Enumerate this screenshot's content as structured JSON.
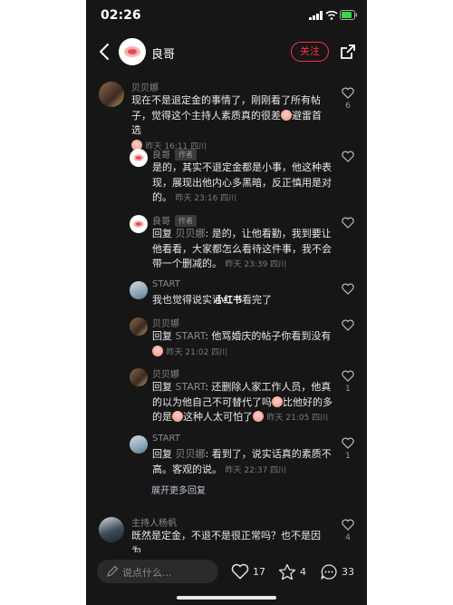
{
  "status": {
    "time": "02:26"
  },
  "header": {
    "name": "良哥",
    "follow_label": "关注"
  },
  "comments": [
    {
      "name": "贝贝娜",
      "text": "现在不是退定金的事情了，刚刚看了所有帖子，觉得这个主持人素质真的很差",
      "text_tail": "避雷首选",
      "meta": "昨天 16:11 四川",
      "likes": "6",
      "replies": [
        {
          "name": "良哥",
          "tag": "作者",
          "text": "是的，其实不退定金都是小事，他这种表现，展现出他内心多黑暗，反正慎用是对的。",
          "meta": "昨天 23:16 四川",
          "likes": ""
        },
        {
          "name": "良哥",
          "tag": "作者",
          "reply_prefix": "回复 ",
          "reply_to": "贝贝娜",
          "text": ": 是的，让他看勤，我到要让他看看，大家都怎么看待这件事，我不会带一个删减的。",
          "meta": "昨天 23:39 四川",
          "likes": ""
        },
        {
          "name": "START",
          "text": "我也觉得说实话",
          "text_tail": "看完了",
          "meta": "",
          "likes": ""
        },
        {
          "name": "贝贝娜",
          "reply_prefix": "回复 ",
          "reply_to": "START",
          "text": ": 他骂婚庆的帖子你看到没有",
          "meta": "昨天 21:02 四川",
          "likes": ""
        },
        {
          "name": "贝贝娜",
          "reply_prefix": "回复 ",
          "reply_to": "START",
          "text": ": 还删除人家工作人员，他真的以为他自己不可替代了吗",
          "text_mid": "比他好的多的是",
          "text_tail": "这种人太可怕了",
          "meta": "昨天 21:05 四川",
          "likes": "1"
        },
        {
          "name": "START",
          "reply_prefix": "回复 ",
          "reply_to": "贝贝娜",
          "text": ": 看到了，说实话真的素质不高。客观的说。",
          "meta": "昨天 22:37 四川",
          "likes": "1"
        }
      ],
      "more_replies": "展开更多回复"
    },
    {
      "name": "主持人杨帆",
      "text": "既然是定金，不退不是很正常吗？也不是因为",
      "likes": "4"
    }
  ],
  "watermark": "小红书",
  "bottom": {
    "placeholder": "说点什么...",
    "likes": "17",
    "stars": "4",
    "comments": "33"
  },
  "colors": {
    "accent": "#ff2e4d",
    "background": "#161616"
  }
}
